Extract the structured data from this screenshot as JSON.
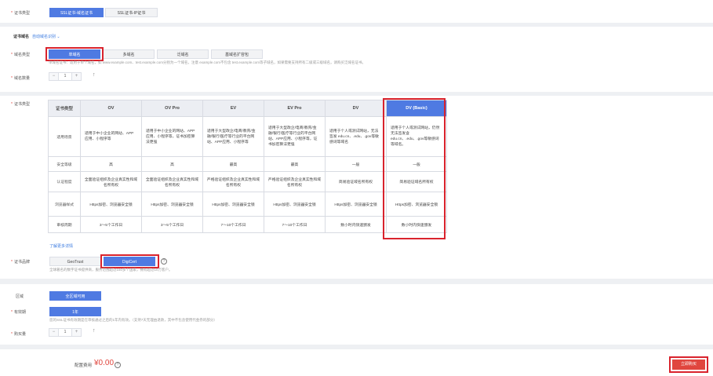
{
  "cert_type_row": {
    "label": "证书类型",
    "options": [
      "SSL证书-域名证书",
      "SSL证书-IP证书"
    ],
    "selected": "SSL证书-域名证书"
  },
  "domain_section": {
    "title": "证书域名",
    "auto_identify": "自动域名识别",
    "domain_type_label": "域名类型",
    "domain_types": [
      "单域名",
      "多域名",
      "泛域名",
      "基域名扩容包"
    ],
    "selected_type": "单域名",
    "hint": "单域名证书：适用于单个域名，如 www.example.com、test.example.com分别为一个域名，注意 example.com不包含 test.example.com等子域名，如果需要支持所有二级或三级域名，请购买泛域名证书。",
    "count_label": "域名数量",
    "count_value": "1",
    "minus": "−",
    "plus": "+"
  },
  "cert_level": {
    "label": "证书类型",
    "row_headers": [
      "证书类型",
      "适用场景",
      "安全等级",
      "认证程度",
      "浏览器样式",
      "审核周期"
    ],
    "columns": [
      {
        "name": "OV",
        "scene": "适用于中小企业的网站、APP应用、小程序等",
        "security": "高",
        "auth": "全面验证组织及企业真实性和域名所有权",
        "browser": "Https加密、浏览器安全锁",
        "period": "3～5个工作日"
      },
      {
        "name": "OV Pro",
        "scene": "适用于中小企业的网站、APP应用、小程序等，证书加密算法更强",
        "security": "高",
        "auth": "全面验证组织及企业真实性和域名所有权",
        "browser": "Https加密、浏览器安全锁",
        "period": "3～5个工作日"
      },
      {
        "name": "EV",
        "scene": "适用于大型政企/电商/教育/金融/银行/医疗等行业的平台网站、APP应用、小程序等",
        "security": "最高",
        "auth": "严格验证组织及企业真实性和域名所有权",
        "browser": "Https加密、浏览器安全锁",
        "period": "7～10个工作日"
      },
      {
        "name": "EV Pro",
        "scene": "适用于大型政企/电商/教育/金融/银行/医疗等行业的平台网站、APP应用、小程序等，证书加密算法更强",
        "security": "最高",
        "auth": "严格验证组织及企业真实性和域名所有权",
        "browser": "Https加密、浏览器安全锁",
        "period": "7～10个工作日"
      },
      {
        "name": "DV",
        "scene": "适用于个人或测试网站，无法签发 edu.cn、.edu、.gov等敏感词等域名",
        "security": "一般",
        "auth": "简易验证域名所有权",
        "browser": "Https加密、浏览器安全锁",
        "period": "数小时内快速颁发"
      },
      {
        "name": "DV (Basic)",
        "scene": "适用于个人或测试网站，仍然无法签发含 edu.cn、.edu、.gov等敏感词等域名。",
        "security": "一般",
        "auth": "简易验证域名所有权",
        "browser": "Https加密、浏览器安全锁",
        "period": "数小时内快速颁发"
      }
    ],
    "selected": "DV (Basic)",
    "more_link": "了解更多详情"
  },
  "brand_row": {
    "label": "证书品牌",
    "options": [
      "GeoTrust",
      "DigiCert"
    ],
    "selected": "DigiCert",
    "help": "?",
    "hint": "全球著名的数字证书提供商，服务范围超过150多个国家，拥有超过10万客户。"
  },
  "region_row": {
    "label": "区域",
    "value": "全区域可用"
  },
  "validity_row": {
    "label": "有效期",
    "value": "1年",
    "hint": "您的SSL证书有效期是在审核通过之后的1年内有效。（支持7天无理由退款，其中不包含使用代金券的部分）"
  },
  "quantity_row": {
    "label": "购买量",
    "value": "1",
    "minus": "−",
    "plus": "+"
  },
  "footer": {
    "cost_label": "配置费用",
    "price": "¥0.00",
    "help": "?",
    "buy_button": "立即购买"
  },
  "colors": {
    "accent": "#4f7ae2",
    "highlight": "#d9232d",
    "price": "#e0463e"
  }
}
